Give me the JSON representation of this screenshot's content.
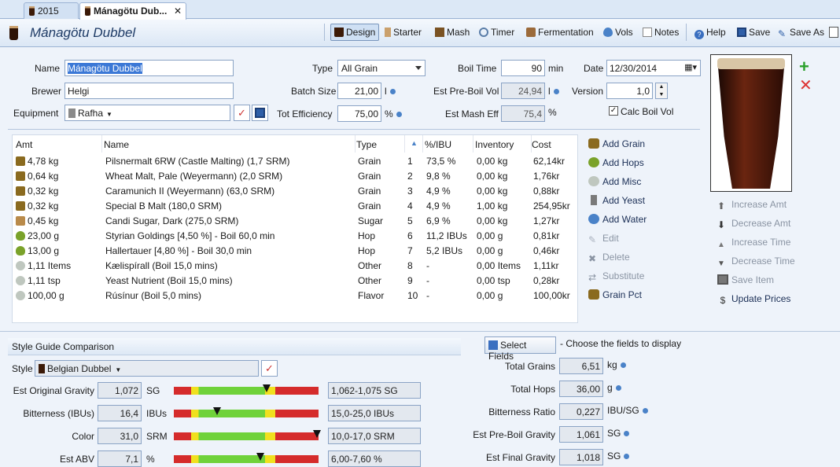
{
  "tabs": [
    {
      "label": "2015"
    },
    {
      "label": "Mánagötu Dub..."
    }
  ],
  "title": "Mánagötu Dubbel",
  "toolbar": {
    "design": "Design",
    "starter": "Starter",
    "mash": "Mash",
    "timer": "Timer",
    "fermentation": "Fermentation",
    "vols": "Vols",
    "notes": "Notes",
    "help": "Help",
    "save": "Save",
    "save_as": "Save As"
  },
  "recipe": {
    "name_label": "Name",
    "name": "Mánagötu Dubbel",
    "brewer_label": "Brewer",
    "brewer": "Helgi",
    "equipment_label": "Equipment",
    "equipment": "Rafha",
    "type_label": "Type",
    "type": "All Grain",
    "batch_label": "Batch Size",
    "batch": "21,00",
    "batch_unit": "l",
    "eff_label": "Tot Efficiency",
    "eff": "75,00",
    "eff_unit": "%",
    "boil_label": "Boil Time",
    "boil": "90",
    "boil_unit": "min",
    "preboil_label": "Est Pre-Boil Vol",
    "preboil": "24,94",
    "preboil_unit": "l",
    "mash_eff_label": "Est Mash Eff",
    "mash_eff": "75,4",
    "mash_eff_unit": "%",
    "date_label": "Date",
    "date": "12/30/2014",
    "version_label": "Version",
    "version": "1,0",
    "calc_label": "Calc Boil Vol"
  },
  "grid": {
    "headers": {
      "amt": "Amt",
      "name": "Name",
      "type": "Type",
      "pct": "%/IBU",
      "inv": "Inventory",
      "cost": "Cost"
    },
    "rows": [
      {
        "icon": "grain",
        "amt": "4,78 kg",
        "name": "Pilsnermalt 6RW (Castle Malting) (1,7 SRM)",
        "type": "Grain",
        "n": "1",
        "pct": "73,5 %",
        "inv": "0,00 kg",
        "cost": "62,14kr"
      },
      {
        "icon": "grain",
        "amt": "0,64 kg",
        "name": "Wheat Malt, Pale (Weyermann) (2,0 SRM)",
        "type": "Grain",
        "n": "2",
        "pct": "9,8 %",
        "inv": "0,00 kg",
        "cost": "1,76kr"
      },
      {
        "icon": "grain",
        "amt": "0,32 kg",
        "name": "Caramunich II (Weyermann) (63,0 SRM)",
        "type": "Grain",
        "n": "3",
        "pct": "4,9 %",
        "inv": "0,00 kg",
        "cost": "0,88kr"
      },
      {
        "icon": "grain",
        "amt": "0,32 kg",
        "name": "Special B Malt (180,0 SRM)",
        "type": "Grain",
        "n": "4",
        "pct": "4,9 %",
        "inv": "1,00 kg",
        "cost": "254,95kr"
      },
      {
        "icon": "sugar",
        "amt": "0,45 kg",
        "name": "Candi Sugar, Dark (275,0 SRM)",
        "type": "Sugar",
        "n": "5",
        "pct": "6,9 %",
        "inv": "0,00 kg",
        "cost": "1,27kr"
      },
      {
        "icon": "hop",
        "amt": "23,00 g",
        "name": "Styrian Goldings [4,50 %] - Boil 60,0 min",
        "type": "Hop",
        "n": "6",
        "pct": "11,2 IBUs",
        "inv": "0,00 g",
        "cost": "0,81kr"
      },
      {
        "icon": "hop",
        "amt": "13,00 g",
        "name": "Hallertauer [4,80 %] - Boil 30,0 min",
        "type": "Hop",
        "n": "7",
        "pct": "5,2 IBUs",
        "inv": "0,00 g",
        "cost": "0,46kr"
      },
      {
        "icon": "other",
        "amt": "1,11 Items",
        "name": "Kælispírall (Boil 15,0 mins)",
        "type": "Other",
        "n": "8",
        "pct": "-",
        "inv": "0,00 Items",
        "cost": "1,11kr"
      },
      {
        "icon": "other",
        "amt": "1,11 tsp",
        "name": "Yeast Nutrient (Boil 15,0 mins)",
        "type": "Other",
        "n": "9",
        "pct": "-",
        "inv": "0,00 tsp",
        "cost": "0,28kr"
      },
      {
        "icon": "other",
        "amt": "100,00 g",
        "name": "Rúsínur (Boil 5,0 mins)",
        "type": "Flavor",
        "n": "10",
        "pct": "-",
        "inv": "0,00 g",
        "cost": "100,00kr"
      }
    ]
  },
  "actions": {
    "add_grain": "Add Grain",
    "add_hops": "Add Hops",
    "add_misc": "Add Misc",
    "add_yeast": "Add Yeast",
    "add_water": "Add Water",
    "edit": "Edit",
    "delete": "Delete",
    "substitute": "Substitute",
    "grain_pct": "Grain Pct"
  },
  "side_actions": {
    "inc_amt": "Increase Amt",
    "dec_amt": "Decrease Amt",
    "inc_time": "Increase Time",
    "dec_time": "Decrease Time",
    "save_item": "Save Item",
    "update_prices": "Update Prices"
  },
  "style": {
    "header": "Style Guide Comparison",
    "style_label": "Style",
    "style": "Belgian Dubbel",
    "rows": [
      {
        "label": "Est Original Gravity",
        "value": "1,072",
        "unit": "SG",
        "range": "1,062-1,075 SG",
        "marker": 0.64
      },
      {
        "label": "Bitterness (IBUs)",
        "value": "16,4",
        "unit": "IBUs",
        "range": "15,0-25,0 IBUs",
        "marker": 0.3
      },
      {
        "label": "Color",
        "value": "31,0",
        "unit": "SRM",
        "range": "10,0-17,0 SRM",
        "marker": 0.99
      },
      {
        "label": "Est ABV",
        "value": "7,1",
        "unit": "%",
        "range": "6,00-7,60 %",
        "marker": 0.6
      }
    ]
  },
  "fields": {
    "button": "Select Fields",
    "hint": "- Choose the fields to display",
    "rows": [
      {
        "label": "Total Grains",
        "value": "6,51",
        "unit": "kg"
      },
      {
        "label": "Total Hops",
        "value": "36,00",
        "unit": "g"
      },
      {
        "label": "Bitterness Ratio",
        "value": "0,227",
        "unit": "IBU/SG"
      },
      {
        "label": "Est Pre-Boil Gravity",
        "value": "1,061",
        "unit": "SG"
      },
      {
        "label": "Est Final Gravity",
        "value": "1,018",
        "unit": "SG"
      }
    ]
  },
  "colors": {
    "accent": "#4a82c8",
    "bar_red": "#d52b2b",
    "bar_green": "#6fd23a",
    "bar_yellow": "#f0e01e"
  }
}
